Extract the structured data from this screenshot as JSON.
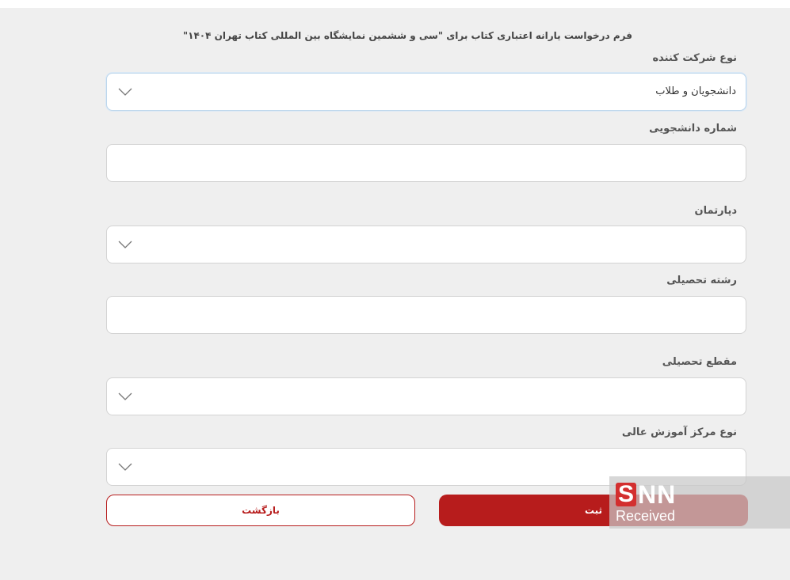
{
  "form": {
    "title": "فرم درخواست یارانه اعتباری کتاب برای \"سی و ششمین نمایشگاه بین المللی کتاب تهران ۱۴۰۴\"",
    "fields": [
      {
        "label": "نوع شرکت کننده",
        "value": "دانشجویان و طلاب",
        "type": "select"
      },
      {
        "label": "شماره دانشجویی",
        "value": "",
        "type": "text"
      },
      {
        "label": "دپارتمان",
        "value": "",
        "type": "select"
      },
      {
        "label": "رشته تحصیلی",
        "value": "",
        "type": "text"
      },
      {
        "label": "مقطع تحصیلی",
        "value": "",
        "type": "select"
      },
      {
        "label": "نوع مرکز آموزش عالی",
        "value": "",
        "type": "select"
      }
    ]
  },
  "buttons": {
    "submit_label": "ثبت",
    "back_label": "بازگشت"
  },
  "watermark": {
    "logo_s": "S",
    "logo_nn": "NN",
    "subtitle": "Received"
  },
  "colors": {
    "accent": "#b71c1c",
    "background": "#efefef",
    "field_border": "#d3d3d3"
  },
  "icons": {
    "dropdown": "chevron-down-icon"
  }
}
